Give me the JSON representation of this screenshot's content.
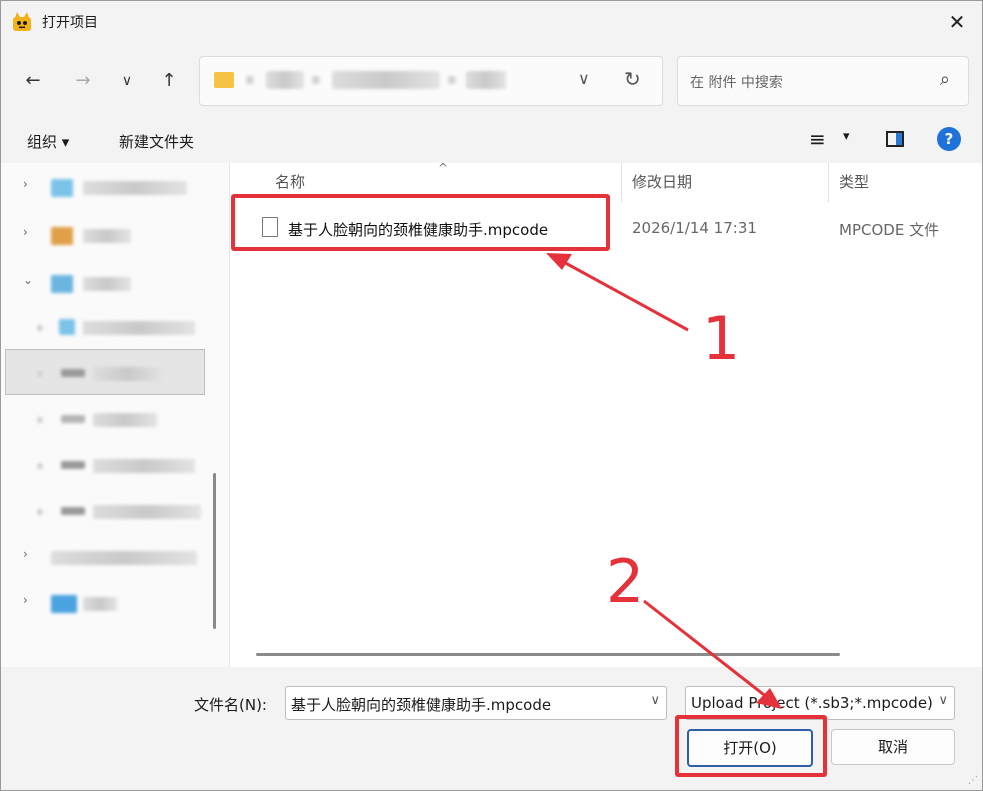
{
  "window": {
    "title": "打开项目",
    "close_icon": "close-icon",
    "app_icon": "app-logo-icon"
  },
  "nav": {
    "back_icon": "←",
    "forward_icon": "→",
    "history_icon": "∨",
    "up_icon": "↑",
    "refresh_icon": "↻",
    "path_dropdown_icon": "∨"
  },
  "search": {
    "placeholder": "在 附件 中搜索",
    "icon": "⌕"
  },
  "toolbar": {
    "organize": "组织 ▾",
    "new_folder": "新建文件夹",
    "view_icon": "≡",
    "view_dropdown": "▾",
    "help": "?"
  },
  "columns": {
    "name": "名称",
    "modified": "修改日期",
    "type": "类型"
  },
  "files": [
    {
      "name": "基于人脸朝向的颈椎健康助手.mpcode",
      "modified": "2026/1/14 17:31",
      "type": "MPCODE 文件"
    }
  ],
  "bottom": {
    "filename_label": "文件名(N):",
    "filename_value": "基于人脸朝向的颈椎健康助手.mpcode",
    "filetype_value": "Upload Project (*.sb3;*.mpcode)",
    "open_label": "打开(O)",
    "cancel_label": "取消"
  },
  "annotations": {
    "step1": "1",
    "step2": "2",
    "color": "#e5313a"
  }
}
